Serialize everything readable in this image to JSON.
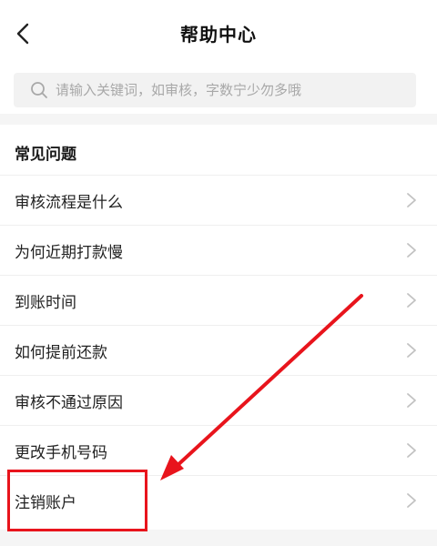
{
  "header": {
    "title": "帮助中心",
    "back_icon": "chevron-left-icon"
  },
  "search": {
    "placeholder": "请输入关键词，如审核，字数宁少勿多哦",
    "value": "",
    "icon": "search-icon"
  },
  "faq": {
    "section_title": "常见问题",
    "items": [
      {
        "label": "审核流程是什么"
      },
      {
        "label": "为何近期打款慢"
      },
      {
        "label": "到账时间"
      },
      {
        "label": "如何提前还款"
      },
      {
        "label": "审核不通过原因"
      },
      {
        "label": "更改手机号码"
      },
      {
        "label": "注销账户"
      }
    ],
    "item_icon": "chevron-right-icon"
  },
  "annotation": {
    "color": "#e8141c",
    "highlighted_item": "注销账户"
  }
}
